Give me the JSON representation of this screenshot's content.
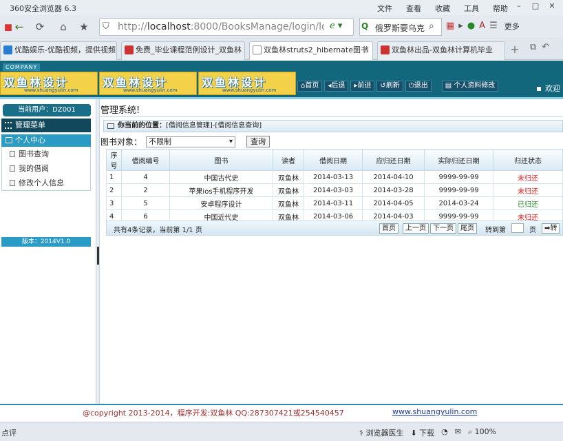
{
  "browser": {
    "app_title": "360安全浏览器 6.3",
    "menus": [
      "文件",
      "查看",
      "收藏",
      "工具",
      "帮助"
    ],
    "address": {
      "prefix": "http://",
      "host": "localhost",
      "rest": ":8000/BooksManage/login/lo"
    },
    "search_text": "俄罗斯要乌克",
    "more_label": "更多",
    "tabs": [
      {
        "label": "优酷娱乐-优酷视频，提供视频"
      },
      {
        "label": "免费_毕业课程范例设计_双鱼林"
      },
      {
        "label": "双鱼林struts2_hibernate图书"
      },
      {
        "label": "双鱼林出品-双鱼林计算机毕业"
      }
    ]
  },
  "header": {
    "company": "COMPANY",
    "banner_text": "双鱼林设计",
    "banner_url": "www.shuangyulin.com",
    "nav": [
      "首页",
      "后退",
      "前进",
      "刷新",
      "退出",
      "个人资料修改"
    ],
    "welcome": "欢迎"
  },
  "sidebar": {
    "current_user": "当前用户：DZ001",
    "menu_title": "管理菜单",
    "group": "个人中心",
    "items": [
      "图书查询",
      "我的借阅",
      "修改个人信息"
    ],
    "version": "版本：2014V1.0"
  },
  "main": {
    "title": "管理系统!",
    "location_label": "你当前的位置：",
    "location_path": "[借阅信息管理]-[借阅信息查询]",
    "filter_label": "图书对象：",
    "filter_value": "不限制",
    "query_button": "查询",
    "columns": [
      "序号",
      "借阅编号",
      "图书",
      "读者",
      "借阅日期",
      "应归还日期",
      "实际归还日期",
      "归还状态"
    ],
    "rows": [
      [
        "1",
        "4",
        "中国古代史",
        "双鱼林",
        "2014-03-13",
        "2014-04-10",
        "9999-99-99",
        "未归还"
      ],
      [
        "2",
        "2",
        "苹果ios手机程序开发",
        "双鱼林",
        "2014-03-03",
        "2014-03-28",
        "9999-99-99",
        "未归还"
      ],
      [
        "3",
        "5",
        "安卓程序设计",
        "双鱼林",
        "2014-03-11",
        "2014-04-05",
        "2014-03-24",
        "已归还"
      ],
      [
        "4",
        "6",
        "中国近代史",
        "双鱼林",
        "2014-03-06",
        "2014-04-03",
        "9999-99-99",
        "未归还"
      ]
    ],
    "pager": {
      "info": "共有4条记录，当前第 1/1 页",
      "first": "首页",
      "prev": "上一页",
      "next": "下一页",
      "last": "尾页",
      "goto": "转到第",
      "page_unit": "页",
      "go": "转"
    }
  },
  "footer": {
    "copyright": "@copyright 2013-2014，程序开发:双鱼林  QQ:287307421或254540457",
    "site": "www.shuangyulin.com"
  },
  "status": {
    "left": "点评",
    "items": [
      "浏览器医生",
      "下载",
      "100%"
    ]
  },
  "colors": {
    "header_bg": "#13677d",
    "accent": "#2a9bc5",
    "status_red": "#d22222",
    "status_green": "#2a8a2a"
  }
}
